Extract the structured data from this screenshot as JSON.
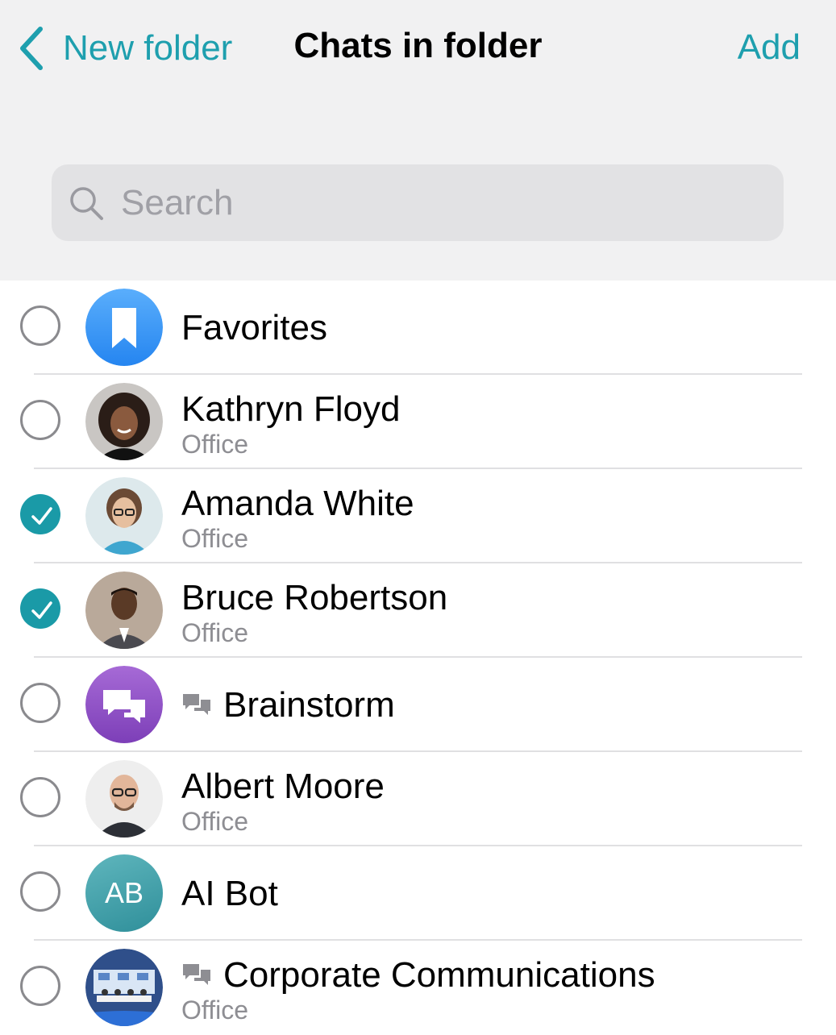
{
  "header": {
    "back_label": "New folder",
    "title": "Chats in folder",
    "action_label": "Add"
  },
  "search": {
    "placeholder": "Search",
    "value": ""
  },
  "colors": {
    "accent": "#1e9fae",
    "checked": "#1a9aa7"
  },
  "chats": [
    {
      "name": "Favorites",
      "subtitle": "",
      "checked": false,
      "avatar": "bookmark-icon"
    },
    {
      "name": "Kathryn Floyd",
      "subtitle": "Office",
      "checked": false,
      "avatar": "photo"
    },
    {
      "name": "Amanda White",
      "subtitle": "Office",
      "checked": true,
      "avatar": "photo"
    },
    {
      "name": "Bruce Robertson",
      "subtitle": "Office",
      "checked": true,
      "avatar": "photo"
    },
    {
      "name": "Brainstorm",
      "subtitle": "",
      "checked": false,
      "avatar": "chat-bubbles-icon",
      "group": true
    },
    {
      "name": "Albert Moore",
      "subtitle": "Office",
      "checked": false,
      "avatar": "photo"
    },
    {
      "name": "AI Bot",
      "subtitle": "",
      "checked": false,
      "avatar": "initials",
      "initials": "AB"
    },
    {
      "name": "Corporate Communications",
      "subtitle": "Office",
      "checked": false,
      "avatar": "photo",
      "group": true
    }
  ]
}
